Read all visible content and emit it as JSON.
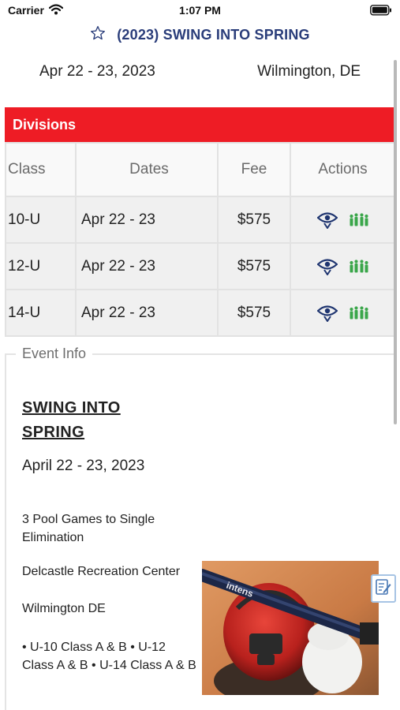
{
  "status_bar": {
    "carrier": "Carrier",
    "time": "1:07 PM"
  },
  "header": {
    "title": "(2023) SWING INTO SPRING",
    "date": "Apr 22 - 23, 2023",
    "location": "Wilmington, DE"
  },
  "divisions": {
    "label": "Divisions",
    "columns": {
      "class": "Class",
      "dates": "Dates",
      "fee": "Fee",
      "actions": "Actions"
    },
    "rows": [
      {
        "class": "10-U",
        "dates": "Apr 22 - 23",
        "fee": "$575"
      },
      {
        "class": "12-U",
        "dates": "Apr 22 - 23",
        "fee": "$575"
      },
      {
        "class": "14-U",
        "dates": "Apr 22 - 23",
        "fee": "$575"
      }
    ]
  },
  "event_info": {
    "legend": "Event Info",
    "title": "SWING  INTO SPRING",
    "date": "April 22 - 23, 2023",
    "format": "3 Pool Games to Single Elimination",
    "venue": "Delcastle Recreation Center",
    "city": "Wilmington DE",
    "classes": "• U-10 Class A & B  • U-12 Class A & B  • U-14 Class A & B"
  },
  "icons": {
    "favorite": "star-outline-icon",
    "view": "eye-icon",
    "teams": "team-roster-icon",
    "notes": "notepad-icon"
  },
  "colors": {
    "brand_red": "#ee1c25",
    "title_navy": "#2a3d7a",
    "teams_green": "#3aa64a"
  }
}
